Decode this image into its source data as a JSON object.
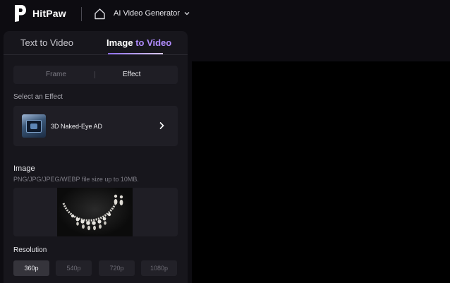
{
  "brand": {
    "name": "HitPaw"
  },
  "header": {
    "product_label": "AI Video Generator"
  },
  "tabs": {
    "text_to_video": "Text to Video",
    "image_to_video_part1": "Image ",
    "image_to_video_part2": "to Video"
  },
  "mode": {
    "frame": "Frame",
    "effect": "Effect"
  },
  "effect": {
    "label": "Select an Effect",
    "selected": "3D Naked-Eye AD"
  },
  "image": {
    "title": "Image",
    "hint": "PNG/JPG/JPEG/WEBP file size up to 10MB."
  },
  "resolution": {
    "title": "Resolution",
    "options": [
      "360p",
      "540p",
      "720p",
      "1080p"
    ],
    "selected": "360p"
  },
  "colors": {
    "accent": "#b18cff",
    "panel": "#17161c",
    "background": "#0d0c11"
  }
}
